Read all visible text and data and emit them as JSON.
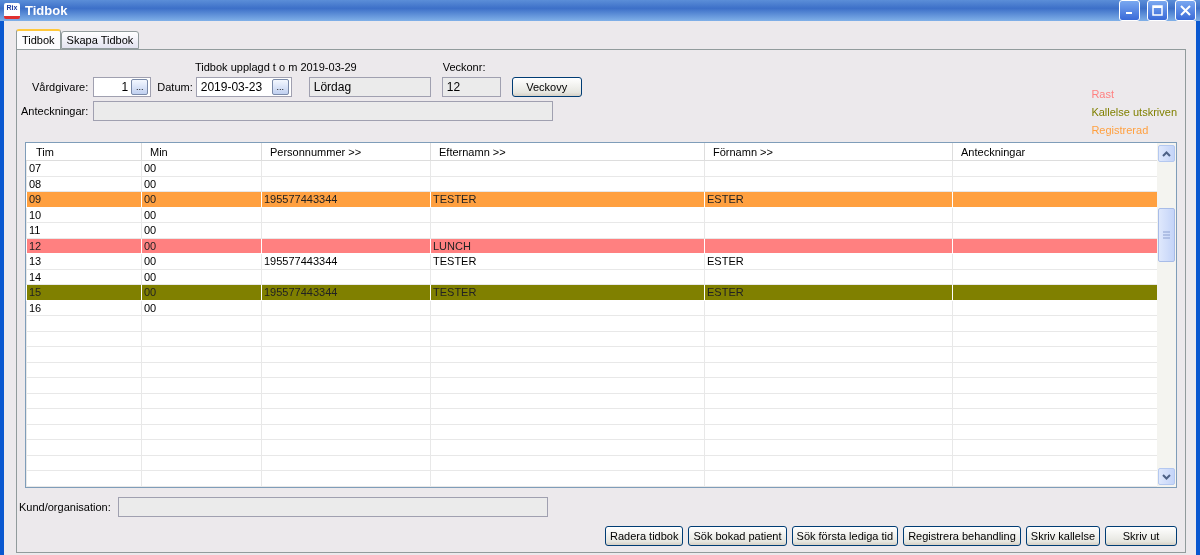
{
  "window": {
    "title": "Tidbok",
    "icon_text": "Rix"
  },
  "tabs": [
    {
      "label": "Tidbok",
      "selected": true
    },
    {
      "label": "Skapa Tidbok",
      "selected": false
    }
  ],
  "form": {
    "caption": "Tidbok upplagd t o m 2019-03-29",
    "vardgivare": {
      "label": "Vårdgivare:",
      "value": "1",
      "picker": "..."
    },
    "datum": {
      "label": "Datum:",
      "value": "2019-03-23",
      "picker": "..."
    },
    "weekday": {
      "value": "Lördag",
      "disabled": true
    },
    "veckonr": {
      "label": "Veckonr:",
      "value": "12",
      "disabled": true
    },
    "veckovy_button": "Veckovy",
    "anteckningar": {
      "label": "Anteckningar:",
      "disabled": true
    }
  },
  "legend": [
    {
      "label": "Rast",
      "color": "#ff8080"
    },
    {
      "label": "Kallelse utskriven",
      "color": "#808000"
    },
    {
      "label": "Registrerad",
      "color": "#ffa040"
    }
  ],
  "table": {
    "columns": [
      "Tim",
      "Min",
      "Personnummer >>",
      "Efternamn >>",
      "Förnamn >>",
      "Anteckningar"
    ],
    "rows": [
      {
        "cells": [
          "07",
          "00",
          "",
          "",
          "",
          ""
        ]
      },
      {
        "cells": [
          "08",
          "00",
          "",
          "",
          "",
          ""
        ]
      },
      {
        "cells": [
          "09",
          "00",
          "195577443344",
          "TESTER",
          "ESTER",
          ""
        ],
        "color": "#ffa040"
      },
      {
        "cells": [
          "10",
          "00",
          "",
          "",
          "",
          ""
        ]
      },
      {
        "cells": [
          "11",
          "00",
          "",
          "",
          "",
          ""
        ]
      },
      {
        "cells": [
          "12",
          "00",
          "",
          "LUNCH",
          "",
          ""
        ],
        "color": "#ff8080"
      },
      {
        "cells": [
          "13",
          "00",
          "195577443344",
          "TESTER",
          "ESTER",
          ""
        ]
      },
      {
        "cells": [
          "14",
          "00",
          "",
          "",
          "",
          ""
        ]
      },
      {
        "cells": [
          "15",
          "00",
          "195577443344",
          "TESTER",
          "ESTER",
          ""
        ],
        "color": "#808000"
      },
      {
        "cells": [
          "16",
          "00",
          "",
          "",
          "",
          ""
        ]
      }
    ]
  },
  "kund": {
    "label": "Kund/organisation:",
    "disabled": true
  },
  "buttons": [
    "Radera tidbok",
    "Sök bokad patient",
    "Sök första lediga tid",
    "Registrera behandling",
    "Skriv kallelse",
    "Skriv ut"
  ]
}
